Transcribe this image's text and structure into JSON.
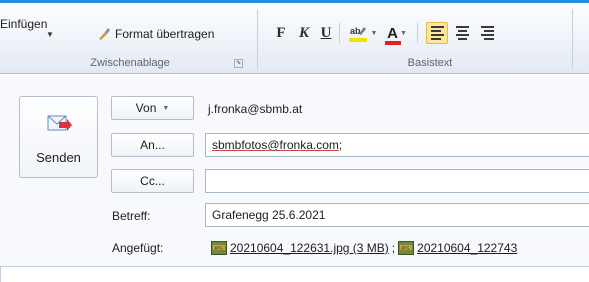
{
  "ribbon": {
    "clipboard": {
      "paste_label": "Einfügen",
      "format_painter_label": "Format übertragen",
      "group_label": "Zwischenablage"
    },
    "basic_text": {
      "bold_label": "F",
      "italic_label": "K",
      "underline_label": "U",
      "font_color_label": "A",
      "group_label": "Basistext",
      "highlight_color": "#f2e200",
      "font_color": "#e0221c"
    }
  },
  "message": {
    "send_label": "Senden",
    "from_label": "Von",
    "from_value": "j.fronka@sbmb.at",
    "to_label": "An...",
    "to_value": "sbmbfotos@fronka.com",
    "to_separator": ";",
    "cc_label": "Cc...",
    "cc_value": "",
    "subject_label": "Betreff:",
    "subject_value": "Grafenegg 25.6.2021",
    "attached_label": "Angefügt:",
    "attachments": [
      {
        "name": "20210604_122631.jpg (3 MB)",
        "icon": "jpeg-file-icon"
      },
      {
        "name": "20210604_122743",
        "icon": "jpeg-file-icon"
      }
    ],
    "attachment_separator": ";"
  },
  "theme": {
    "accent": "#1f8fe0",
    "ribbon_bg": "#eef2f8",
    "active_button": "#fde89a"
  }
}
